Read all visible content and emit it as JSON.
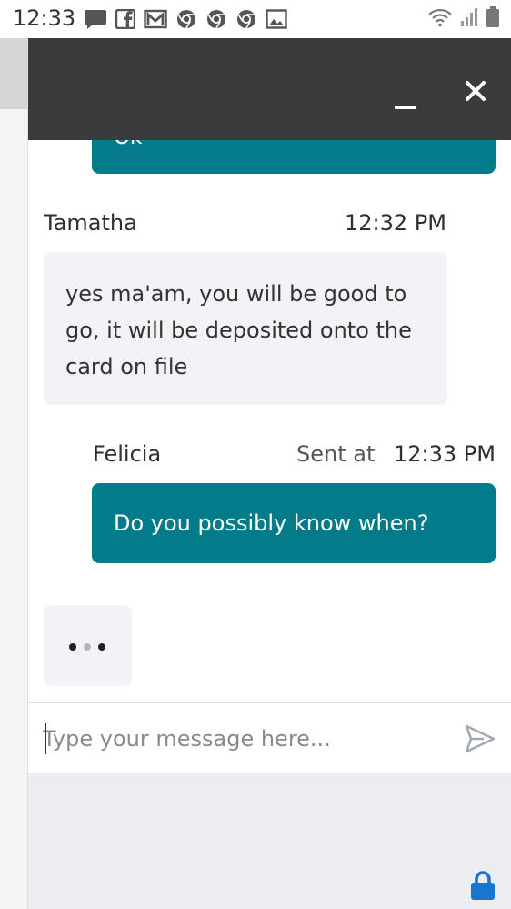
{
  "status_bar": {
    "time": "12:33",
    "notification_icons": [
      "message-icon",
      "facebook-icon",
      "gmail-icon",
      "chrome-icon",
      "chrome-icon",
      "chrome-icon",
      "gallery-icon"
    ],
    "system_icons": [
      "wifi-icon",
      "signal-icon",
      "battery-icon"
    ]
  },
  "chat": {
    "header": {
      "minimize_icon": "minimize-icon",
      "close_icon": "close-icon"
    },
    "messages": [
      {
        "sender": "",
        "text": "Ok",
        "direction": "outgoing",
        "partial": true
      },
      {
        "sender": "Tamatha",
        "time": "12:32 PM",
        "text": "yes ma'am, you will be good to go, it will be deposited onto the card on file",
        "direction": "incoming"
      },
      {
        "sender": "Felicia",
        "sent_at_label": "Sent at",
        "time": "12:33 PM",
        "text": "Do you possibly know when?",
        "direction": "outgoing"
      }
    ],
    "typing_indicator": {
      "visible": true,
      "dots": 3
    },
    "input": {
      "value": "",
      "placeholder": "Type your message here..."
    },
    "send_icon": "send-icon",
    "lock_icon": "lock-icon"
  },
  "colors": {
    "header_bg": "#3a3b3d",
    "outgoing_bubble": "#037b8a",
    "incoming_bubble": "#f2f3f7",
    "footer_bg": "#ecedf1",
    "lock": "#1676d2"
  }
}
